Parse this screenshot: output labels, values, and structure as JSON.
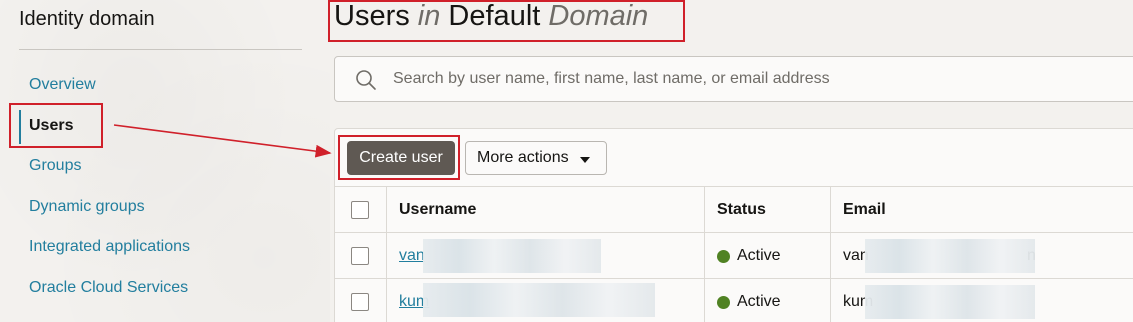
{
  "sidebar": {
    "title": "Identity domain",
    "items": [
      {
        "label": "Overview"
      },
      {
        "label": "Users"
      },
      {
        "label": "Groups"
      },
      {
        "label": "Dynamic groups"
      },
      {
        "label": "Integrated applications"
      },
      {
        "label": "Oracle Cloud Services"
      }
    ],
    "active_item": "Users"
  },
  "header": {
    "title_part1": "Users ",
    "title_in": "in",
    "title_part2": " Default ",
    "title_domain": "Domain"
  },
  "search": {
    "placeholder": "Search by user name, first name, last name, or email address",
    "icon": "search-icon"
  },
  "toolbar": {
    "create_label": "Create user",
    "more_actions_label": "More actions"
  },
  "table": {
    "columns": [
      "Username",
      "Status",
      "Email"
    ],
    "rows": [
      {
        "username": "van",
        "status": "Active",
        "email_prefix": "van",
        "email_suffix": "n"
      },
      {
        "username": "kum",
        "status": "Active",
        "email_prefix": "kum",
        "email_suffix": ""
      }
    ]
  },
  "colors": {
    "accent": "#227e9e",
    "primary_button": "#5f5953",
    "status_active": "#508223",
    "annotation": "#d0202a"
  }
}
